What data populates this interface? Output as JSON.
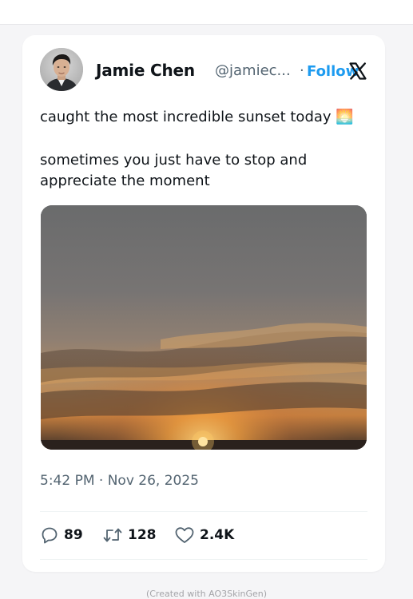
{
  "tweet": {
    "author_name": "Jamie Chen",
    "author_handle": "@jamiec...",
    "separator": "·",
    "follow_label": "Follow",
    "text_line_1": "caught the most incredible sunset today",
    "text_line_1_emoji": "🌅",
    "text_line_2": "sometimes you just have to stop and appreciate the moment",
    "timestamp": "5:42 PM · Nov 26, 2025",
    "stats": {
      "replies": "89",
      "reposts": "128",
      "likes": "2.4K"
    }
  },
  "icons": {
    "platform": "x-logo-icon",
    "reply": "reply-icon",
    "repost": "repost-icon",
    "like": "heart-icon"
  },
  "colors": {
    "follow_blue": "#1d9bf0",
    "text_primary": "#0f1419",
    "text_secondary": "#536471",
    "page_background": "#f5f5f7"
  },
  "footer": {
    "credit": "(Created with AO3SkinGen)"
  }
}
